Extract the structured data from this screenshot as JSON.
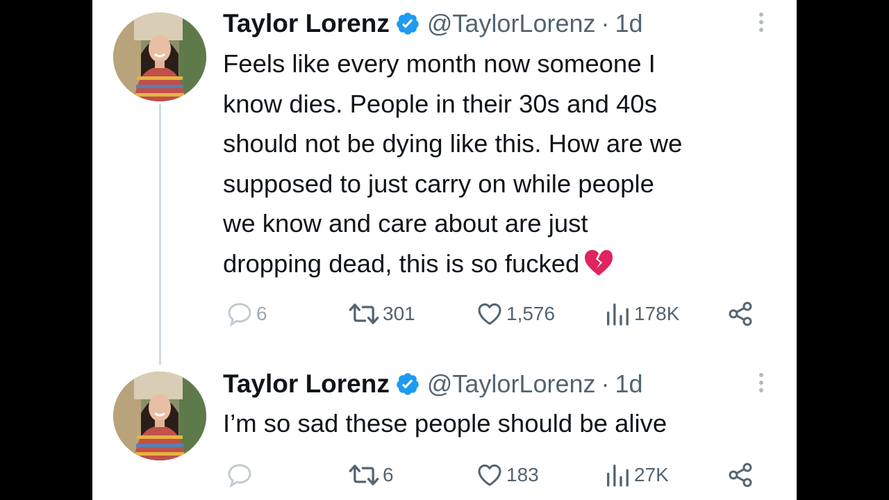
{
  "tweets": [
    {
      "author_name": "Taylor Lorenz",
      "handle": "@TaylorLorenz",
      "separator": "·",
      "time": "1d",
      "text": "Feels like every month now someone I\nknow dies. People in their 30s and 40s\nshould not be dying like this. How are we\nsupposed to just carry on while people\nwe know and care about are just\ndropping dead, this is so fucked",
      "emoji": "broken-heart",
      "replies": "6",
      "retweets": "301",
      "likes": "1,576",
      "views": "178K"
    },
    {
      "author_name": "Taylor Lorenz",
      "handle": "@TaylorLorenz",
      "separator": "·",
      "time": "1d",
      "text": "I’m so sad these people should be alive",
      "replies": "",
      "retweets": "6",
      "likes": "183",
      "views": "27K"
    }
  ],
  "icons": {
    "verified": "verified-badge-icon",
    "more": "more-vertical-icon",
    "reply": "reply-icon",
    "retweet": "retweet-icon",
    "like": "heart-icon",
    "views": "views-icon",
    "share": "share-icon"
  },
  "colors": {
    "verified": "#1d9bf0",
    "text": "#0f1419",
    "secondary": "#536471",
    "thread_line": "#cfd9de",
    "broken_heart": "#e0245e"
  }
}
